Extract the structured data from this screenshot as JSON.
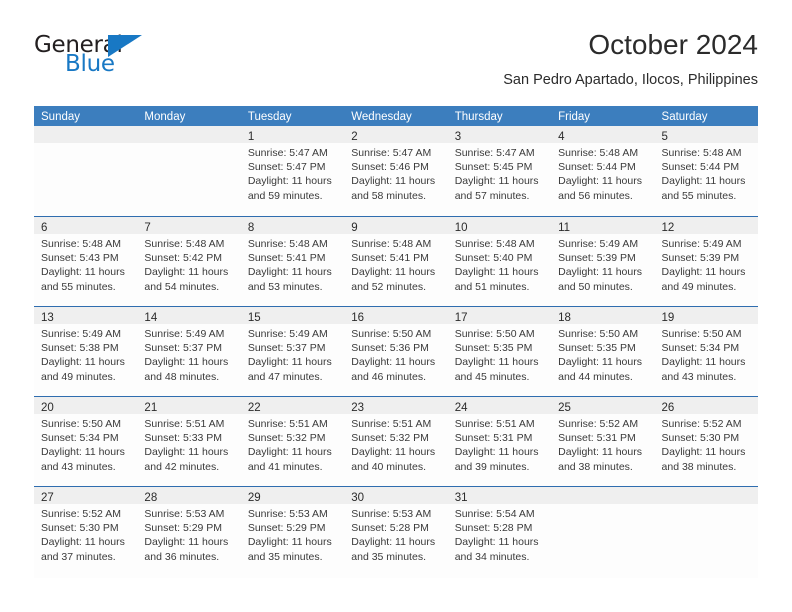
{
  "brand": {
    "name_top": "General",
    "name_bottom": "Blue",
    "accent_color": "#1878c4",
    "triangle_icon": "triangle-logo-icon"
  },
  "header": {
    "title": "October 2024",
    "location": "San Pedro Apartado, Ilocos, Philippines"
  },
  "calendar": {
    "header_color": "#3c7ebe",
    "row_line_color": "#2f6daf",
    "daynum_band_color": "#efefef",
    "weekdays": [
      "Sunday",
      "Monday",
      "Tuesday",
      "Wednesday",
      "Thursday",
      "Friday",
      "Saturday"
    ],
    "weeks": [
      [
        {
          "day": ""
        },
        {
          "day": ""
        },
        {
          "day": "1",
          "sunrise": "Sunrise: 5:47 AM",
          "sunset": "Sunset: 5:47 PM",
          "daylight": "Daylight: 11 hours and 59 minutes."
        },
        {
          "day": "2",
          "sunrise": "Sunrise: 5:47 AM",
          "sunset": "Sunset: 5:46 PM",
          "daylight": "Daylight: 11 hours and 58 minutes."
        },
        {
          "day": "3",
          "sunrise": "Sunrise: 5:47 AM",
          "sunset": "Sunset: 5:45 PM",
          "daylight": "Daylight: 11 hours and 57 minutes."
        },
        {
          "day": "4",
          "sunrise": "Sunrise: 5:48 AM",
          "sunset": "Sunset: 5:44 PM",
          "daylight": "Daylight: 11 hours and 56 minutes."
        },
        {
          "day": "5",
          "sunrise": "Sunrise: 5:48 AM",
          "sunset": "Sunset: 5:44 PM",
          "daylight": "Daylight: 11 hours and 55 minutes."
        }
      ],
      [
        {
          "day": "6",
          "sunrise": "Sunrise: 5:48 AM",
          "sunset": "Sunset: 5:43 PM",
          "daylight": "Daylight: 11 hours and 55 minutes."
        },
        {
          "day": "7",
          "sunrise": "Sunrise: 5:48 AM",
          "sunset": "Sunset: 5:42 PM",
          "daylight": "Daylight: 11 hours and 54 minutes."
        },
        {
          "day": "8",
          "sunrise": "Sunrise: 5:48 AM",
          "sunset": "Sunset: 5:41 PM",
          "daylight": "Daylight: 11 hours and 53 minutes."
        },
        {
          "day": "9",
          "sunrise": "Sunrise: 5:48 AM",
          "sunset": "Sunset: 5:41 PM",
          "daylight": "Daylight: 11 hours and 52 minutes."
        },
        {
          "day": "10",
          "sunrise": "Sunrise: 5:48 AM",
          "sunset": "Sunset: 5:40 PM",
          "daylight": "Daylight: 11 hours and 51 minutes."
        },
        {
          "day": "11",
          "sunrise": "Sunrise: 5:49 AM",
          "sunset": "Sunset: 5:39 PM",
          "daylight": "Daylight: 11 hours and 50 minutes."
        },
        {
          "day": "12",
          "sunrise": "Sunrise: 5:49 AM",
          "sunset": "Sunset: 5:39 PM",
          "daylight": "Daylight: 11 hours and 49 minutes."
        }
      ],
      [
        {
          "day": "13",
          "sunrise": "Sunrise: 5:49 AM",
          "sunset": "Sunset: 5:38 PM",
          "daylight": "Daylight: 11 hours and 49 minutes."
        },
        {
          "day": "14",
          "sunrise": "Sunrise: 5:49 AM",
          "sunset": "Sunset: 5:37 PM",
          "daylight": "Daylight: 11 hours and 48 minutes."
        },
        {
          "day": "15",
          "sunrise": "Sunrise: 5:49 AM",
          "sunset": "Sunset: 5:37 PM",
          "daylight": "Daylight: 11 hours and 47 minutes."
        },
        {
          "day": "16",
          "sunrise": "Sunrise: 5:50 AM",
          "sunset": "Sunset: 5:36 PM",
          "daylight": "Daylight: 11 hours and 46 minutes."
        },
        {
          "day": "17",
          "sunrise": "Sunrise: 5:50 AM",
          "sunset": "Sunset: 5:35 PM",
          "daylight": "Daylight: 11 hours and 45 minutes."
        },
        {
          "day": "18",
          "sunrise": "Sunrise: 5:50 AM",
          "sunset": "Sunset: 5:35 PM",
          "daylight": "Daylight: 11 hours and 44 minutes."
        },
        {
          "day": "19",
          "sunrise": "Sunrise: 5:50 AM",
          "sunset": "Sunset: 5:34 PM",
          "daylight": "Daylight: 11 hours and 43 minutes."
        }
      ],
      [
        {
          "day": "20",
          "sunrise": "Sunrise: 5:50 AM",
          "sunset": "Sunset: 5:34 PM",
          "daylight": "Daylight: 11 hours and 43 minutes."
        },
        {
          "day": "21",
          "sunrise": "Sunrise: 5:51 AM",
          "sunset": "Sunset: 5:33 PM",
          "daylight": "Daylight: 11 hours and 42 minutes."
        },
        {
          "day": "22",
          "sunrise": "Sunrise: 5:51 AM",
          "sunset": "Sunset: 5:32 PM",
          "daylight": "Daylight: 11 hours and 41 minutes."
        },
        {
          "day": "23",
          "sunrise": "Sunrise: 5:51 AM",
          "sunset": "Sunset: 5:32 PM",
          "daylight": "Daylight: 11 hours and 40 minutes."
        },
        {
          "day": "24",
          "sunrise": "Sunrise: 5:51 AM",
          "sunset": "Sunset: 5:31 PM",
          "daylight": "Daylight: 11 hours and 39 minutes."
        },
        {
          "day": "25",
          "sunrise": "Sunrise: 5:52 AM",
          "sunset": "Sunset: 5:31 PM",
          "daylight": "Daylight: 11 hours and 38 minutes."
        },
        {
          "day": "26",
          "sunrise": "Sunrise: 5:52 AM",
          "sunset": "Sunset: 5:30 PM",
          "daylight": "Daylight: 11 hours and 38 minutes."
        }
      ],
      [
        {
          "day": "27",
          "sunrise": "Sunrise: 5:52 AM",
          "sunset": "Sunset: 5:30 PM",
          "daylight": "Daylight: 11 hours and 37 minutes."
        },
        {
          "day": "28",
          "sunrise": "Sunrise: 5:53 AM",
          "sunset": "Sunset: 5:29 PM",
          "daylight": "Daylight: 11 hours and 36 minutes."
        },
        {
          "day": "29",
          "sunrise": "Sunrise: 5:53 AM",
          "sunset": "Sunset: 5:29 PM",
          "daylight": "Daylight: 11 hours and 35 minutes."
        },
        {
          "day": "30",
          "sunrise": "Sunrise: 5:53 AM",
          "sunset": "Sunset: 5:28 PM",
          "daylight": "Daylight: 11 hours and 35 minutes."
        },
        {
          "day": "31",
          "sunrise": "Sunrise: 5:54 AM",
          "sunset": "Sunset: 5:28 PM",
          "daylight": "Daylight: 11 hours and 34 minutes."
        },
        {
          "day": ""
        },
        {
          "day": ""
        }
      ]
    ]
  }
}
